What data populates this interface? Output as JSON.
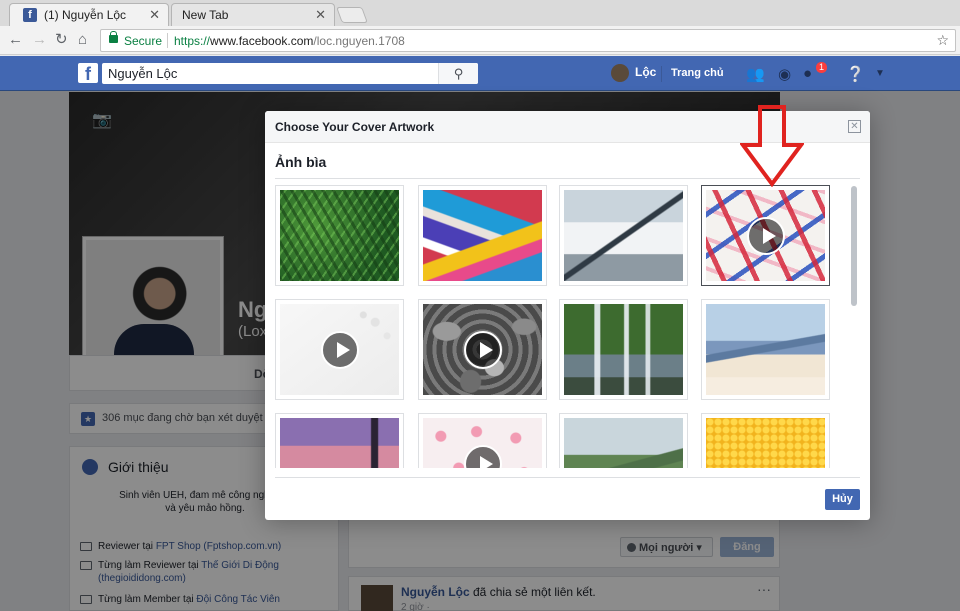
{
  "browser": {
    "tabs": [
      {
        "title": "(1) Nguyễn Lộc",
        "active": true
      },
      {
        "title": "New Tab",
        "active": false
      }
    ],
    "secure_label": "Secure",
    "url": {
      "proto": "https://",
      "host": "www.facebook.com",
      "path": "/loc.nguyen.1708"
    }
  },
  "fb_header": {
    "logo": "f",
    "search_value": "Nguyễn Lộc",
    "user_name": "Lộc",
    "home_label": "Trang chủ",
    "notification_count": "1"
  },
  "profile": {
    "name_partial": "Ng",
    "alt_name_partial": "(Lox",
    "tab_partial": "Dò",
    "pending_text": "306 mục đang chờ bạn xét duyệt",
    "intro": {
      "title": "Giới thiệu",
      "bio_line1": "Sinh viên UEH, đam mê công nghệ. Gi",
      "bio_line2": "và yêu mảo hồng.",
      "items": [
        {
          "prefix": "Reviewer tại ",
          "link": "FPT Shop (Fptshop.com.vn)",
          "suffix": ""
        },
        {
          "prefix": "Từng làm Reviewer tại ",
          "link": "Thế Giới Di Động",
          "suffix": "",
          "line2": "(thegioididong.com)"
        },
        {
          "prefix": "Từng làm Member tại ",
          "link": "Đội Công Tác Viên",
          "suffix": ""
        }
      ]
    },
    "composer": {
      "audience": "Mọi người",
      "post_button": "Đăng"
    },
    "post": {
      "author": "Nguyễn Lộc",
      "action": " đã chia sẻ một liên kết.",
      "time": "2 giờ · ",
      "more": "···"
    }
  },
  "dialog": {
    "title": "Choose Your Cover Artwork",
    "section": "Ảnh bìa",
    "cancel_label": "Hủy",
    "artworks": [
      {
        "name": "fern-leaves",
        "video": false,
        "selected": false
      },
      {
        "name": "paint-strokes",
        "video": false,
        "selected": false
      },
      {
        "name": "snowy-mountain",
        "video": false,
        "selected": false
      },
      {
        "name": "crossed-ribbons",
        "video": true,
        "selected": true
      },
      {
        "name": "white-bubbles",
        "video": true,
        "selected": false
      },
      {
        "name": "pebbles",
        "video": true,
        "selected": false
      },
      {
        "name": "waterfall",
        "video": false,
        "selected": false
      },
      {
        "name": "misty-mountains",
        "video": false,
        "selected": false
      },
      {
        "name": "lighthouse-sunset",
        "video": false,
        "selected": false
      },
      {
        "name": "pink-hearts",
        "video": true,
        "selected": false
      },
      {
        "name": "green-valley",
        "video": false,
        "selected": false
      },
      {
        "name": "yellow-pattern",
        "video": false,
        "selected": false
      }
    ]
  },
  "colors": {
    "fb_blue": "#4267b2",
    "annotation_red": "#e0231f"
  }
}
